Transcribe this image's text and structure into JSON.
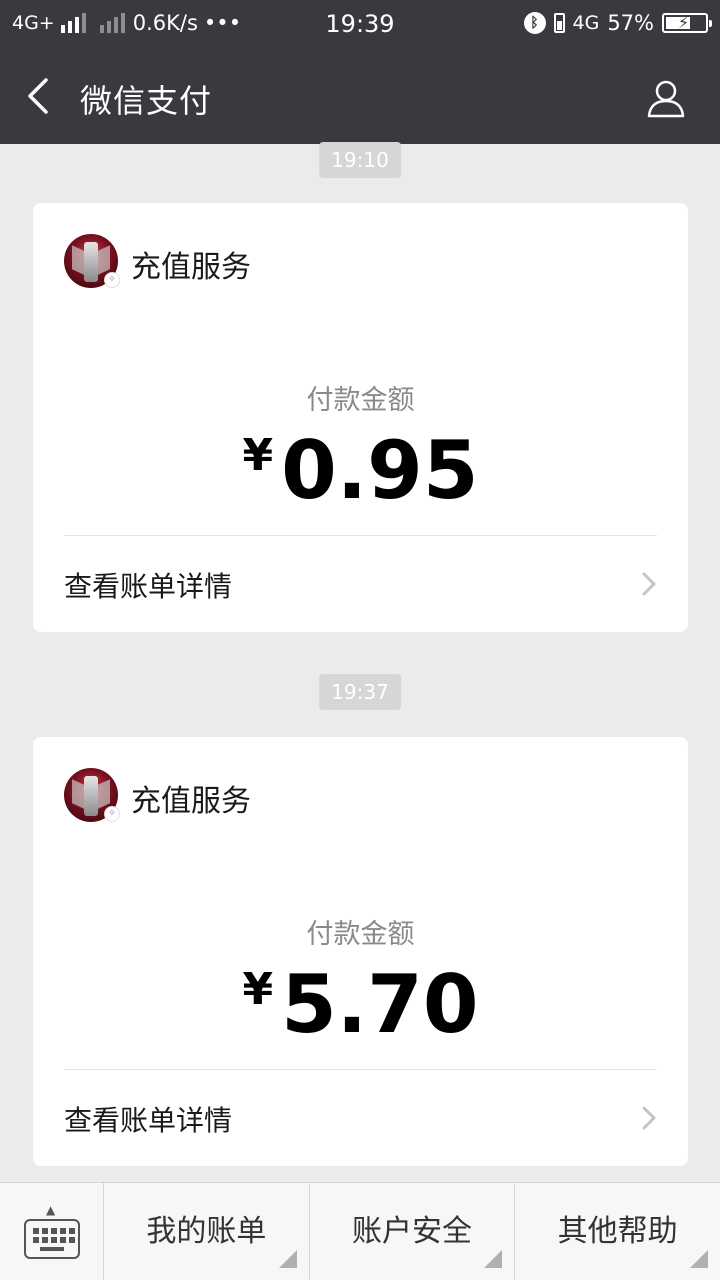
{
  "status_bar": {
    "network_left": "4G+",
    "speed": "0.6K/s",
    "more": "•••",
    "time": "19:39",
    "network_right": "4G",
    "battery": "57%"
  },
  "nav": {
    "title": "微信支付",
    "back_icon": "chevron-left-icon",
    "profile_icon": "person-icon"
  },
  "messages": [
    {
      "time": "19:10",
      "merchant": "充值服务",
      "amount_label": "付款金额",
      "currency": "¥",
      "amount": "0.95",
      "detail_link": "查看账单详情"
    },
    {
      "time": "19:37",
      "merchant": "充值服务",
      "amount_label": "付款金额",
      "currency": "¥",
      "amount": "5.70",
      "detail_link": "查看账单详情"
    }
  ],
  "bottom_menu": {
    "keyboard_icon": "keyboard-icon",
    "items": [
      {
        "label": "我的账单"
      },
      {
        "label": "账户安全"
      },
      {
        "label": "其他帮助"
      }
    ]
  },
  "colors": {
    "header": "#393a3f",
    "background": "#ebebeb",
    "card": "#ffffff",
    "time_chip": "#d6d6d6"
  }
}
